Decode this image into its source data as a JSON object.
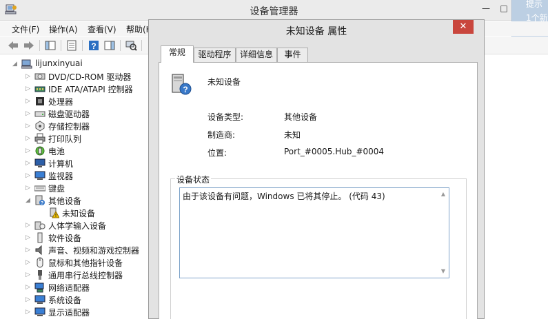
{
  "window": {
    "title": "设备管理器"
  },
  "hint": {
    "line1": "提示",
    "line2": "1个新"
  },
  "menu": [
    "文件(F)",
    "操作(A)",
    "查看(V)",
    "帮助(H"
  ],
  "tree": {
    "root": "lijunxinyuai",
    "items": [
      "DVD/CD-ROM 驱动器",
      "IDE ATA/ATAPI 控制器",
      "处理器",
      "磁盘驱动器",
      "存储控制器",
      "打印队列",
      "电池",
      "计算机",
      "监视器",
      "键盘",
      "其他设备",
      "未知设备",
      "人体学输入设备",
      "软件设备",
      "声音、视频和游戏控制器",
      "鼠标和其他指针设备",
      "通用串行总线控制器",
      "网络适配器",
      "系统设备",
      "显示适配器"
    ]
  },
  "dialog": {
    "title": "未知设备 属性",
    "close": "✕",
    "tabs": [
      "常规",
      "驱动程序",
      "详细信息",
      "事件"
    ],
    "device_name": "未知设备",
    "props": [
      {
        "label": "设备类型:",
        "value": "其他设备"
      },
      {
        "label": "制造商:",
        "value": "未知"
      },
      {
        "label": "位置:",
        "value": "Port_#0005.Hub_#0004"
      }
    ],
    "status_group": "设备状态",
    "status_text": "由于该设备有问题，Windows 已将其停止。 (代码 43)"
  }
}
